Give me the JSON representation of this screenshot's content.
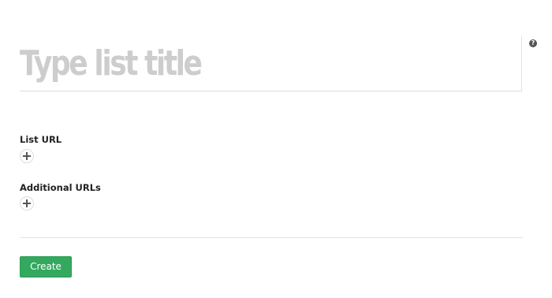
{
  "title_field": {
    "value": "",
    "placeholder": "Type list title"
  },
  "help": {
    "icon": "question-circle-icon",
    "glyph": "?"
  },
  "list_url": {
    "label": "List URL",
    "add_icon": "plus-icon"
  },
  "additional_urls": {
    "label": "Additional URLs",
    "add_icon": "plus-icon"
  },
  "actions": {
    "create_label": "Create"
  },
  "colors": {
    "create_button": "#33a95f",
    "placeholder_text": "#cdcdcd"
  }
}
